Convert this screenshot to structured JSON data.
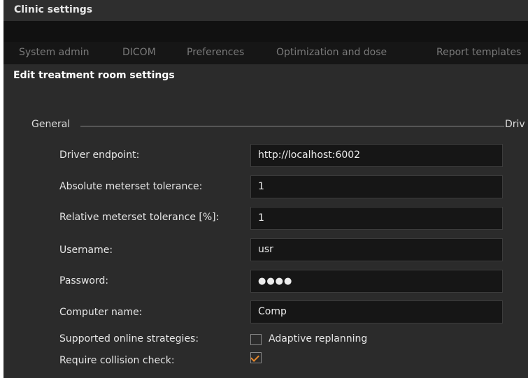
{
  "window": {
    "title": "Clinic settings"
  },
  "tabs": [
    {
      "label": "System admin"
    },
    {
      "label": "DICOM"
    },
    {
      "label": "Preferences"
    },
    {
      "label": "Optimization and dose"
    },
    {
      "label": "Report templates"
    }
  ],
  "page": {
    "title": "Edit treatment room settings"
  },
  "section": {
    "label": "General",
    "next_label": "Driv"
  },
  "fields": {
    "driver_endpoint": {
      "label": "Driver endpoint:",
      "value": "http://localhost:6002"
    },
    "abs_tolerance": {
      "label": "Absolute meterset tolerance:",
      "value": "1"
    },
    "rel_tolerance": {
      "label": "Relative meterset tolerance [%]:",
      "value": "1"
    },
    "username": {
      "label": "Username:",
      "value": "usr"
    },
    "password": {
      "label": "Password:",
      "value": "●●●●"
    },
    "computer_name": {
      "label": "Computer name:",
      "value": "Comp"
    }
  },
  "online_strategies": {
    "label": "Supported online strategies:",
    "option_label": "Adaptive replanning",
    "checked": false
  },
  "collision_check": {
    "label": "Require collision check:",
    "checked": true
  },
  "colors": {
    "accent": "#e8892b",
    "background": "#2b2b2b",
    "field_bg": "#161616"
  }
}
